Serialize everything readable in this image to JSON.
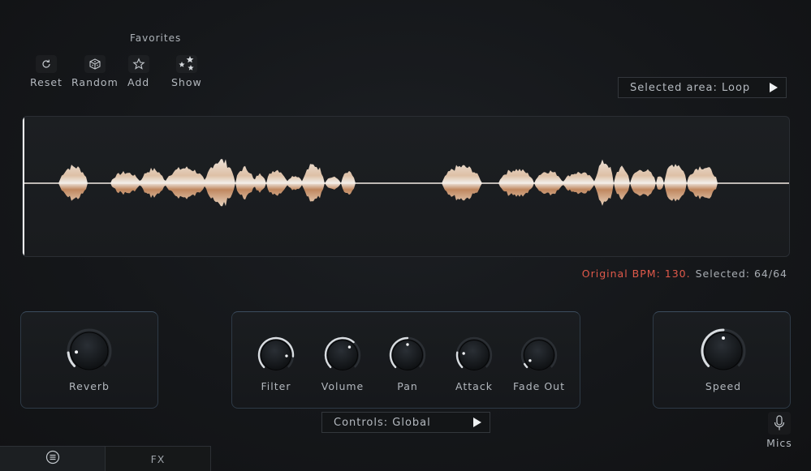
{
  "favorites": {
    "title": "Favorites",
    "tools": [
      {
        "label": "Reset",
        "icon": "reset-icon"
      },
      {
        "label": "Random",
        "icon": "dice-icon"
      },
      {
        "label": "Add",
        "icon": "star-icon"
      },
      {
        "label": "Show",
        "icon": "stars-icon"
      }
    ]
  },
  "selected_area": {
    "label": "Selected area: Loop",
    "icon": "play-icon"
  },
  "bpm": {
    "original": "Original BPM: 130.",
    "selected": "Selected: 64/64"
  },
  "knobs": {
    "reverb": {
      "label": "Reverb",
      "level": 0.15
    },
    "filter": {
      "label": "Filter",
      "level": 0.85
    },
    "volume": {
      "label": "Volume",
      "level": 0.65
    },
    "pan": {
      "label": "Pan",
      "level": 0.5
    },
    "attack": {
      "label": "Attack",
      "level": 0.2
    },
    "fade_out": {
      "label": "Fade Out",
      "level": 0.05
    },
    "speed": {
      "label": "Speed",
      "level": 0.5
    }
  },
  "controls": {
    "label": "Controls: Global",
    "icon": "play-icon"
  },
  "mics": {
    "label": "Mics",
    "icon": "microphone-icon"
  },
  "tabs": {
    "main_icon": "menu-list-icon",
    "fx": "FX"
  },
  "colors": {
    "accent_red": "#e0594a",
    "waveform": "#f2e3d3",
    "knob_arc": "#d9dde1",
    "panel_border": "#3c4d5e"
  }
}
